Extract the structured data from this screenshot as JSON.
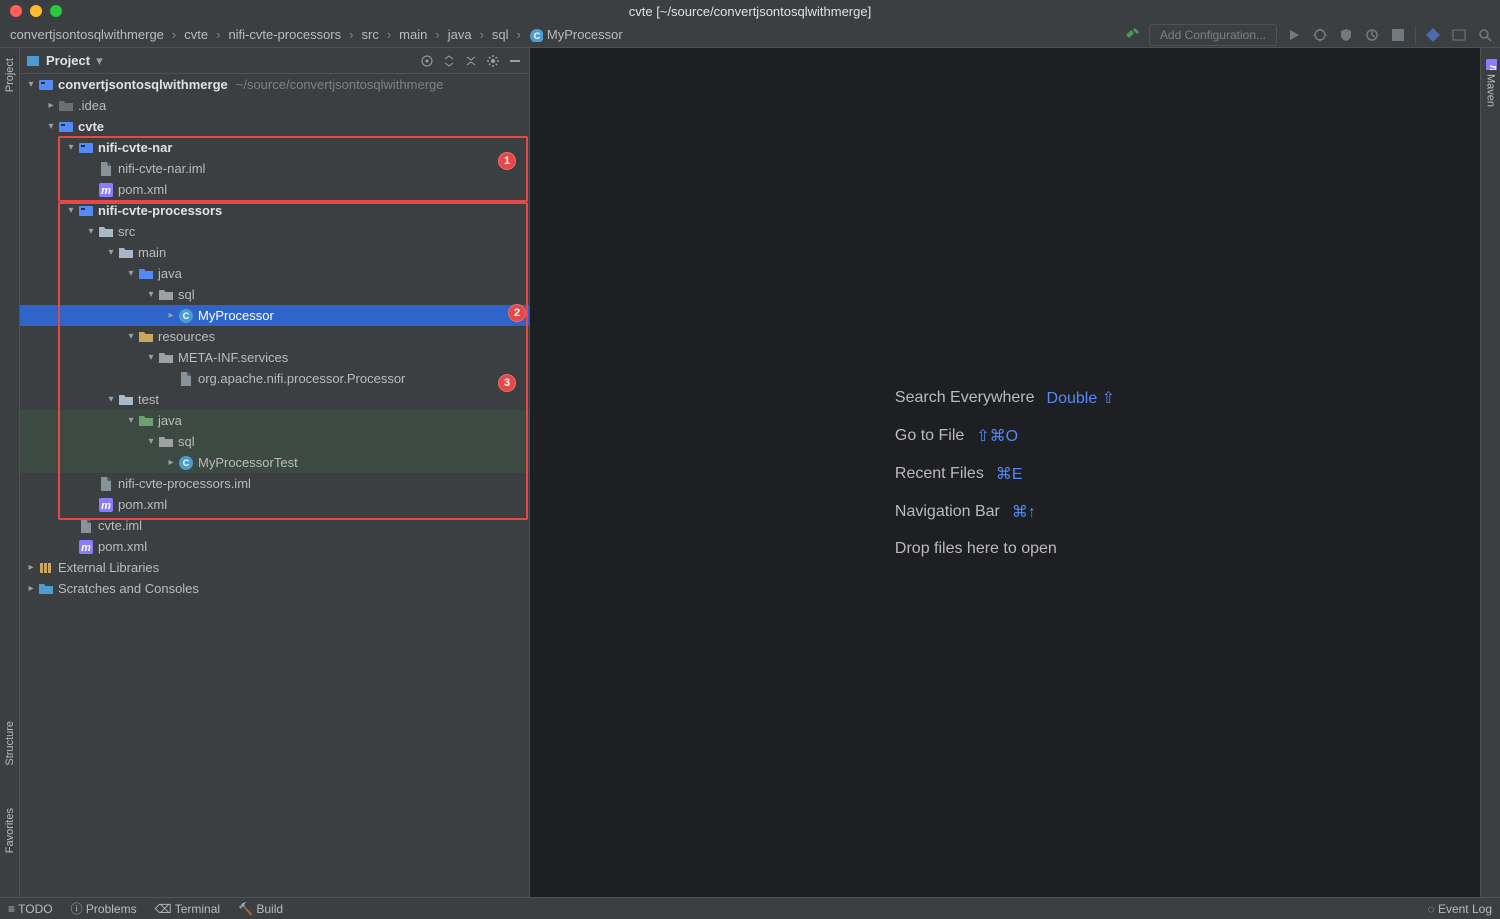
{
  "window": {
    "title": "cvte [~/source/convertjsontosqlwithmerge]"
  },
  "breadcrumbs": [
    {
      "label": "convertjsontosqlwithmerge",
      "icon": "module"
    },
    {
      "label": "cvte",
      "icon": "module"
    },
    {
      "label": "nifi-cvte-processors",
      "icon": "module"
    },
    {
      "label": "src",
      "icon": "folder"
    },
    {
      "label": "main",
      "icon": "folder"
    },
    {
      "label": "java",
      "icon": "folder-src"
    },
    {
      "label": "sql",
      "icon": "package"
    },
    {
      "label": "MyProcessor",
      "icon": "class"
    }
  ],
  "run": {
    "add_configuration": "Add Configuration..."
  },
  "project_pane": {
    "title": "Project"
  },
  "tree": {
    "root": {
      "name": "convertjsontosqlwithmerge",
      "path_hint": "~/source/convertjsontosqlwithmerge"
    },
    "idea": ".idea",
    "cvte": "cvte",
    "nar_mod": "nifi-cvte-nar",
    "nar_iml": "nifi-cvte-nar.iml",
    "nar_pom": "pom.xml",
    "proc_mod": "nifi-cvte-processors",
    "src": "src",
    "main": "main",
    "java_main": "java",
    "sql_main": "sql",
    "my_processor": "MyProcessor",
    "resources": "resources",
    "meta_inf": "META-INF.services",
    "spi_file": "org.apache.nifi.processor.Processor",
    "test": "test",
    "java_test": "java",
    "sql_test": "sql",
    "my_processor_test": "MyProcessorTest",
    "proc_iml": "nifi-cvte-processors.iml",
    "proc_pom": "pom.xml",
    "cvte_iml": "cvte.iml",
    "cvte_pom": "pom.xml",
    "ext_lib": "External Libraries",
    "scratches": "Scratches and Consoles"
  },
  "annotations": {
    "badge1": "1",
    "badge2": "2",
    "badge3": "3"
  },
  "hints": {
    "search_label": "Search Everywhere",
    "search_key": "Double ⇧",
    "goto_label": "Go to File",
    "goto_key": "⇧⌘O",
    "recent_label": "Recent Files",
    "recent_key": "⌘E",
    "nav_label": "Navigation Bar",
    "nav_key": "⌘↑",
    "drop_label": "Drop files here to open"
  },
  "gutters": {
    "left_project": "Project",
    "left_structure": "Structure",
    "left_favorites": "Favorites",
    "right_maven": "Maven"
  },
  "status": {
    "todo": "TODO",
    "problems": "Problems",
    "terminal": "Terminal",
    "build": "Build",
    "event_log": "Event Log"
  }
}
